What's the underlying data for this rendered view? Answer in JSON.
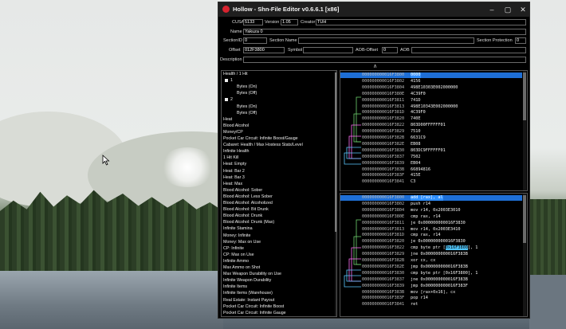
{
  "window": {
    "title": "Hollow - Shn-File Editor v0.6.6.1 [x86]"
  },
  "fields": {
    "cusa_label": "CUSA",
    "cusa_value": "5133",
    "version_label": "Version",
    "version_value": "1.05",
    "creator_label": "Creator",
    "creator_value": "TUH",
    "name_label": "Name",
    "name_value": "Yakuza 0",
    "sectionid_label": "SectionID",
    "sectionid_value": "0",
    "sectionname_label": "Section Name",
    "sectionname_value": "",
    "sectionprot_label": "Section Protection",
    "sectionprot_value": "0",
    "offset_label": "Offset",
    "offset_value": "012F3800",
    "symbol_label": "Symbol",
    "symbol_value": "",
    "aoboffset_label": "AOB-Offset",
    "aoboffset_value": "0",
    "aob_label": "AOB",
    "aob_value": "",
    "description_label": "Description",
    "description_value": "",
    "collapse_glyph": "∧"
  },
  "cheats": [
    "Health / 1 Hit",
    "1",
    "Bytes (On)",
    "Bytes (Off)",
    "2",
    "Bytes (On)",
    "Bytes (Off)",
    "Heat",
    "Blood Alcohol",
    "Money/CP",
    "Pocket Car Circuit: Infinite Boost/Gauge",
    "Cabaret: Health / Max Hostess Stats/Level",
    "Infinite Health",
    "1 Hit Kill",
    "Heat: Empty",
    "Heat: Bar 2",
    "Heat: Bar 3",
    "Heat: Max",
    "Blood Alcohol: Sober",
    "Blood Alcohol: Less Sober",
    "Blood Alcohol: Alcoholized",
    "Blood Alcohol: Bit Drunk",
    "Blood Alcohol: Drunk",
    "Blood Alcohol: Drunk (Max)",
    "Infinite Stamina",
    "Money: Infinite",
    "Money: Max on Use",
    "CP: Infinite",
    "CP: Max on Use",
    "Infinite Ammo",
    "Max Ammo on Shot",
    "Max Weapon Durability on Use",
    "Infinite Weapon Durability",
    "Infinite Items",
    "Infinite Items (Warehouse)",
    "Real Estate: Instant Payout",
    "Pocket Car Circuit: Infinite Boost",
    "Pocket Car Circuit: Infinite Gauge"
  ],
  "hex_rows": [
    {
      "addr": "000000000016F3800",
      "val": "0000"
    },
    {
      "addr": "000000000016F3802",
      "val": "4156"
    },
    {
      "addr": "000000000016F3804",
      "val": "498E10303E002000000"
    },
    {
      "addr": "000000000016F380E",
      "val": "4C39F0"
    },
    {
      "addr": "000000000016F3811",
      "val": "741D"
    },
    {
      "addr": "000000000016F3813",
      "val": "498E10343E002000000"
    },
    {
      "addr": "000000000016F381D",
      "val": "4C39F0"
    },
    {
      "addr": "000000000016F3820",
      "val": "740E"
    },
    {
      "addr": "000000000016F3822",
      "val": "803D00FFFFFF01"
    },
    {
      "addr": "000000000016F3829",
      "val": "7510"
    },
    {
      "addr": "000000000016F382B",
      "val": "6631C9"
    },
    {
      "addr": "000000000016F382E",
      "val": "EB08"
    },
    {
      "addr": "000000000016F3830",
      "val": "803DC9FFFFFF01"
    },
    {
      "addr": "000000000016F3837",
      "val": "7502"
    },
    {
      "addr": "000000000016F3839",
      "val": "EB04"
    },
    {
      "addr": "000000000016F383B",
      "val": "66894816"
    },
    {
      "addr": "000000000016F383F",
      "val": "415E"
    },
    {
      "addr": "000000000016F3841",
      "val": "C3"
    }
  ],
  "asm_rows": [
    {
      "addr": "000000000016F3800",
      "val": "add [rax], al"
    },
    {
      "addr": "000000000016F3802",
      "val": "push r14"
    },
    {
      "addr": "000000000016F3804",
      "val": "mov r14, 0x2003E3010"
    },
    {
      "addr": "000000000016F380E",
      "val": "cmp rax, r14"
    },
    {
      "addr": "000000000016F3811",
      "val": "je 0x000000000016F3830"
    },
    {
      "addr": "000000000016F3813",
      "val": "mov r14, 0x2003E3410"
    },
    {
      "addr": "000000000016F381D",
      "val": "cmp rax, r14"
    },
    {
      "addr": "000000000016F3820",
      "val": "je 0x000000000016F3830"
    },
    {
      "addr": "000000000016F3822",
      "val": "cmp byte ptr [0x16F3800], 1",
      "hl": "0x16F3800"
    },
    {
      "addr": "000000000016F3829",
      "val": "jne 0x000000000016F383B"
    },
    {
      "addr": "000000000016F382B",
      "val": "xor cx, cx"
    },
    {
      "addr": "000000000016F382E",
      "val": "jmp 0x000000000016F383B"
    },
    {
      "addr": "000000000016F3830",
      "val": "cmp byte ptr [0x16F3800], 1"
    },
    {
      "addr": "000000000016F3837",
      "val": "jne 0x000000000016F383B"
    },
    {
      "addr": "000000000016F3839",
      "val": "jmp 0x000000000016F383F"
    },
    {
      "addr": "000000000016F383B",
      "val": "mov [rax+0x16], cx"
    },
    {
      "addr": "000000000016F383F",
      "val": "pop r14"
    },
    {
      "addr": "000000000016F3841",
      "val": "ret"
    }
  ]
}
